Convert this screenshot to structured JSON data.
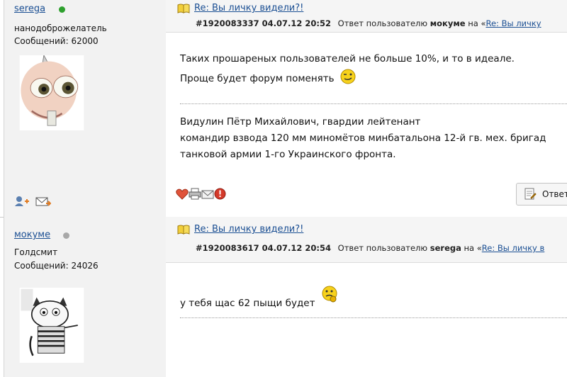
{
  "posts": [
    {
      "author": {
        "name": "serega",
        "status": "online",
        "status_color": "#2ea02e",
        "rank": "нанодоброжелатель",
        "messages": "Сообщений: 62000"
      },
      "title": "Re: Вы личку видели?!",
      "meta": {
        "id_date": "#1920083337 04.07.12 20:52",
        "reply_prefix": "Ответ пользователю",
        "reply_user": "мокуме",
        "on": "на «",
        "reply_link": "Re: Вы личку"
      },
      "body": [
        "Таких прошареных пользователей не больше 10%, и то в идеале.",
        "Проще будет форум поменять"
      ],
      "signature": [
        "Видулин Пётр Михайлович, гвардии лейтенант",
        "командир взвода 120 мм миномётов минбатальона 12-й гв. мех. бригад",
        "танковой армии 1-го Украинского фронта."
      ],
      "reply_label": "Ответ"
    },
    {
      "author": {
        "name": "мокуме",
        "status": "offline",
        "status_color": "#a8a8a8",
        "rank": "Голдсмит",
        "messages": "Сообщений: 24026"
      },
      "title": "Re: Вы личку видели?!",
      "meta": {
        "id_date": "#1920083617 04.07.12 20:54",
        "reply_prefix": "Ответ пользователю",
        "reply_user": "serega",
        "on": "на «",
        "reply_link": "Re: Вы личку в"
      },
      "body": [
        "у тебя щас 62 пыщи будет"
      ]
    }
  ]
}
